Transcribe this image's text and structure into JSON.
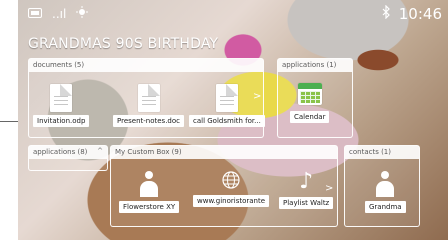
{
  "status_bar": {
    "left_icons": [
      "sim-card-icon",
      "signal-bars-icon",
      "brightness-icon"
    ],
    "right_icons": [
      "bluetooth-icon"
    ],
    "time": "10:46",
    "signal_text": "..ıl"
  },
  "page": {
    "title": "GRANDMAS 90S BIRTHDAY"
  },
  "boxes": {
    "documents": {
      "header": "documents (5)",
      "items": [
        {
          "label": "Invitation.odp",
          "icon": "document-icon"
        },
        {
          "label": "Present-notes.doc",
          "icon": "document-icon"
        },
        {
          "label": "call Goldsmith for...",
          "icon": "document-icon"
        }
      ],
      "more_arrow": ">"
    },
    "applications_top": {
      "header": "applications (1)",
      "items": [
        {
          "label": "Calendar",
          "icon": "calendar-icon"
        }
      ]
    },
    "applications_collapsed": {
      "header": "applications (8)",
      "caret": "^"
    },
    "custom_box": {
      "header": "My Custom Box (9)",
      "items": [
        {
          "label": "Flowerstore XY",
          "icon": "person-icon"
        },
        {
          "label": "www.ginoristorante",
          "icon": "globe-icon"
        },
        {
          "label": "Playlist Waltz",
          "icon": "music-note-icon"
        }
      ],
      "more_arrow": ">"
    },
    "contacts": {
      "header": "contacts (1)",
      "items": [
        {
          "label": "Grandma",
          "icon": "person-icon"
        }
      ]
    }
  }
}
